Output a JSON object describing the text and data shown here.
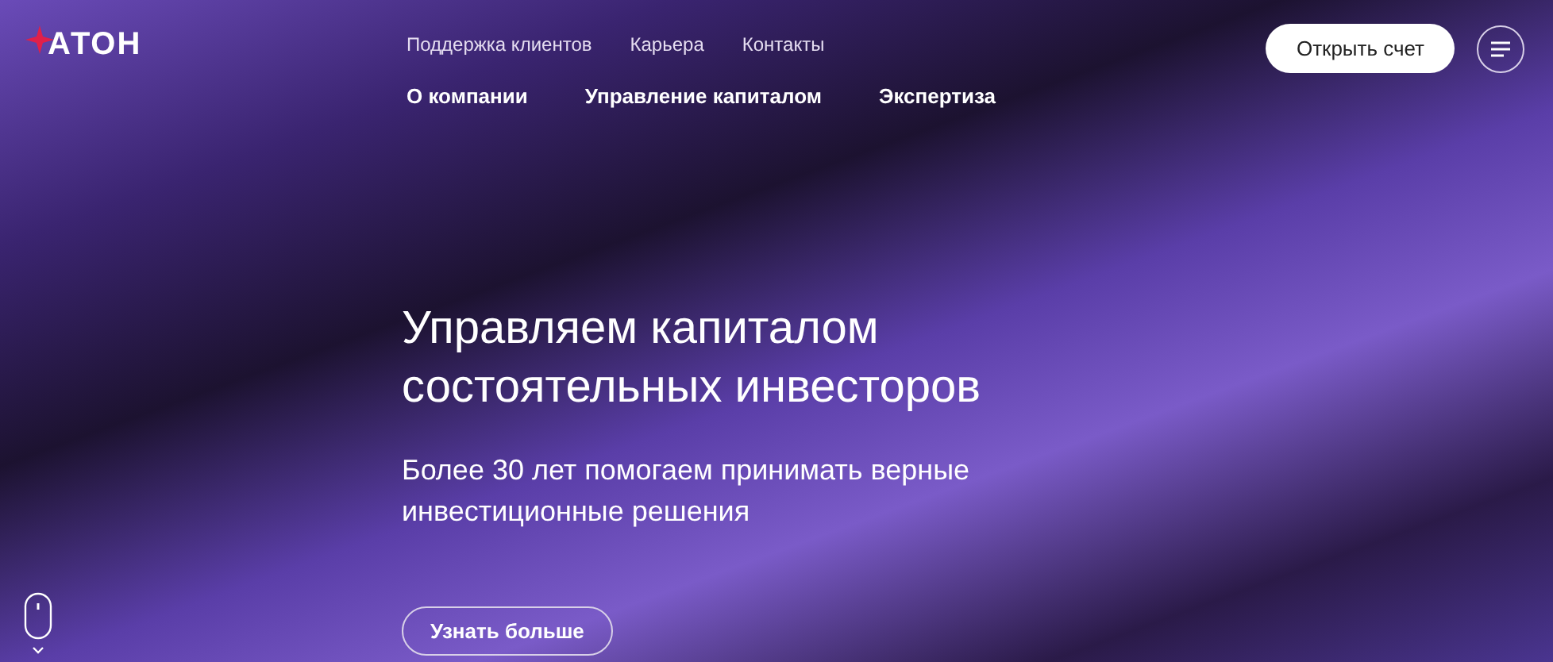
{
  "logo": {
    "text": "АТОН"
  },
  "top_links": [
    "Поддержка клиентов",
    "Карьера",
    "Контакты"
  ],
  "main_nav": [
    "О компании",
    "Управление капиталом",
    "Экспертиза"
  ],
  "open_account_button": "Открыть счет",
  "hero": {
    "title": [
      "Управляем капиталом",
      "состоятельных инвесторов"
    ],
    "subtitle": [
      "Более 30 лет помогаем принимать верные",
      "инвестиционные решения"
    ],
    "button": "Узнать больше"
  }
}
